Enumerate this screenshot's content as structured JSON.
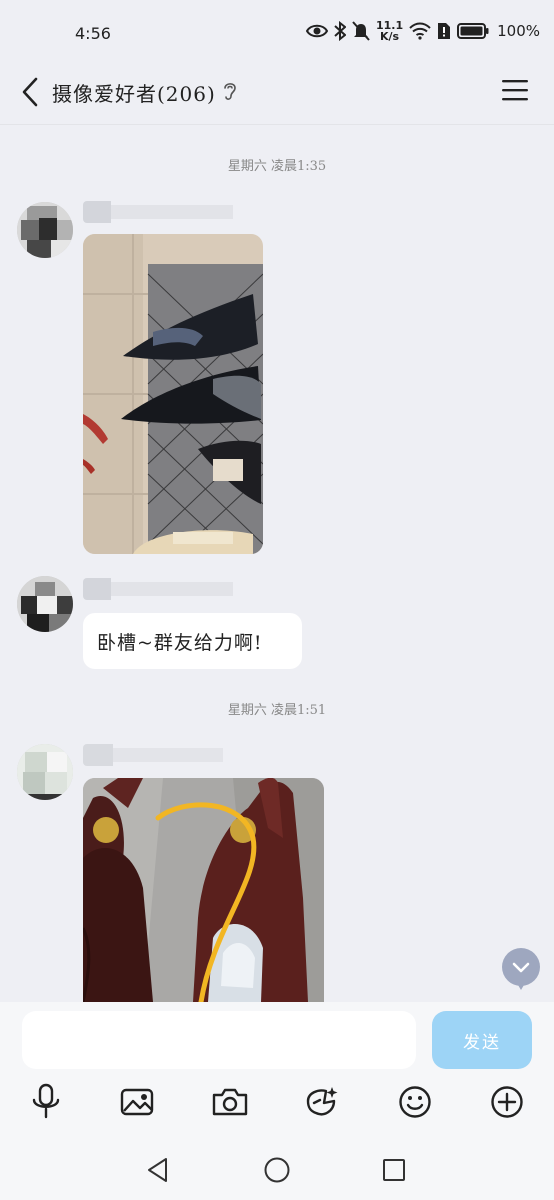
{
  "status_bar": {
    "time": "4:56",
    "net_speed_value": "11.1",
    "net_speed_unit": "K/s",
    "battery": "100%"
  },
  "header": {
    "title": "摄像爱好者(206)",
    "back_icon": "chevron-left-icon",
    "ear_icon": "ear-icon",
    "menu_icon": "hamburger-menu-icon"
  },
  "messages": {
    "timestamp_1": "星期六  凌晨1:35",
    "timestamp_2": "星期六  凌晨1:51",
    "text_message": "卧槽~群友给力啊!"
  },
  "input": {
    "placeholder": "",
    "send_label": "发送"
  },
  "toolbar": [
    "microphone-icon",
    "image-icon",
    "camera-icon",
    "sticker-icon",
    "emoji-icon",
    "plus-icon"
  ],
  "system_nav": [
    "back-triangle-icon",
    "home-circle-icon",
    "recents-square-icon"
  ],
  "colors": {
    "background": "#eeeff4",
    "send_button": "#9dd4f6",
    "scroll_button": "#9ea7bf"
  }
}
